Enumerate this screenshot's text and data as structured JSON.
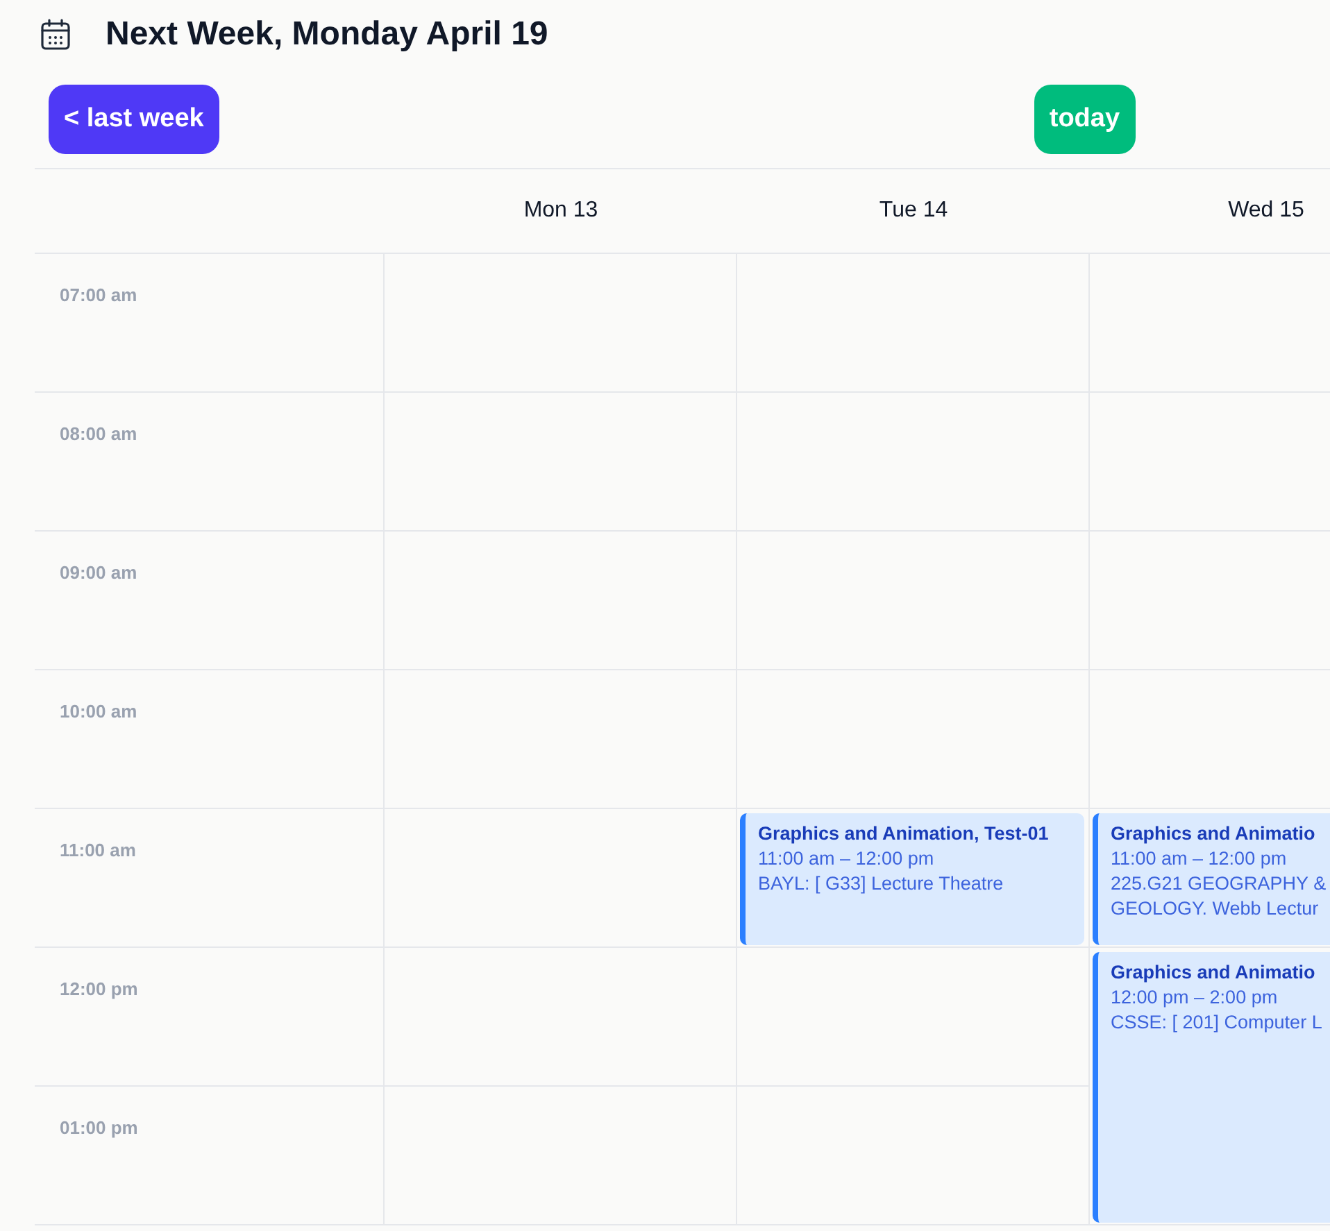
{
  "header": {
    "title": "Next Week, Monday April 19"
  },
  "toolbar": {
    "buttons": [
      {
        "label": "< last week",
        "kind": "previous"
      },
      {
        "label": "today",
        "kind": "today"
      }
    ]
  },
  "calendar": {
    "days": [
      {
        "label": "Mon 13"
      },
      {
        "label": "Tue 14"
      },
      {
        "label": "Wed 15"
      }
    ],
    "rows": [
      {
        "time": "07:00 am",
        "cells": [
          {},
          {},
          {}
        ]
      },
      {
        "time": "08:00 am",
        "cells": [
          {},
          {},
          {}
        ]
      },
      {
        "time": "09:00 am",
        "cells": [
          {},
          {},
          {}
        ]
      },
      {
        "time": "10:00 am",
        "cells": [
          {},
          {},
          {}
        ]
      },
      {
        "time": "11:00 am",
        "cells": [
          {},
          {
            "event": {
              "title": "Graphics and Animation, Test-01",
              "time": "11:00 am – 12:00 pm",
              "location": "BAYL: [ G33] Lecture Theatre",
              "kind": "short"
            }
          },
          {
            "event": {
              "title": "Graphics and Animatio",
              "time": "11:00 am – 12:00 pm",
              "location": "225.G21 GEOGRAPHY & GEOLOGY. Webb Lectur",
              "kind": "short"
            }
          }
        ]
      },
      {
        "time": "12:00 pm",
        "cells": [
          {},
          {},
          {
            "event": {
              "title": "Graphics and Animatio",
              "time": "12:00 pm – 2:00 pm",
              "location": "CSSE: [ 201] Computer L",
              "kind": "long"
            }
          }
        ]
      },
      {
        "time": "01:00 pm",
        "cells": [
          {},
          {}
        ]
      }
    ]
  }
}
